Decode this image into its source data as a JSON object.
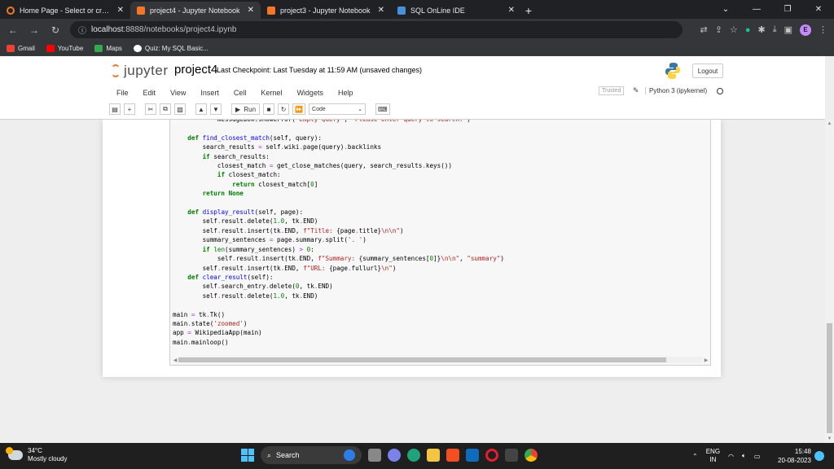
{
  "browser": {
    "tabs": [
      {
        "label": "Home Page - Select or create a n",
        "active": false
      },
      {
        "label": "project4 - Jupyter Notebook",
        "active": true
      },
      {
        "label": "project3 - Jupyter Notebook",
        "active": false
      },
      {
        "label": "SQL OnLine IDE",
        "active": false
      }
    ],
    "url_host": "localhost",
    "url_rest": ":8888/notebooks/project4.ipynb",
    "bookmarks": [
      {
        "label": "Gmail",
        "color": "#ea4335"
      },
      {
        "label": "YouTube",
        "color": "#ff0000"
      },
      {
        "label": "Maps",
        "color": "#34a853"
      },
      {
        "label": "Quiz: My SQL Basic...",
        "color": "#ffffff"
      }
    ],
    "profile_initial": "E"
  },
  "jupyter": {
    "logo_text": "jupyter",
    "notebook_name": "project4",
    "checkpoint_text": "Last Checkpoint: Last Tuesday at 11:59 AM  (unsaved changes)",
    "logout_label": "Logout",
    "menu": [
      "File",
      "Edit",
      "View",
      "Insert",
      "Cell",
      "Kernel",
      "Widgets",
      "Help"
    ],
    "trusted_label": "Trusted",
    "kernel_name": "Python 3 (ipykernel)",
    "toolbar": {
      "run_label": "Run",
      "cell_type": "Code"
    }
  },
  "taskbar": {
    "temperature": "34°C",
    "weather": "Mostly cloudy",
    "search_label": "Search",
    "lang_top": "ENG",
    "lang_bottom": "IN",
    "time": "15:48",
    "date": "20-08-2023"
  }
}
